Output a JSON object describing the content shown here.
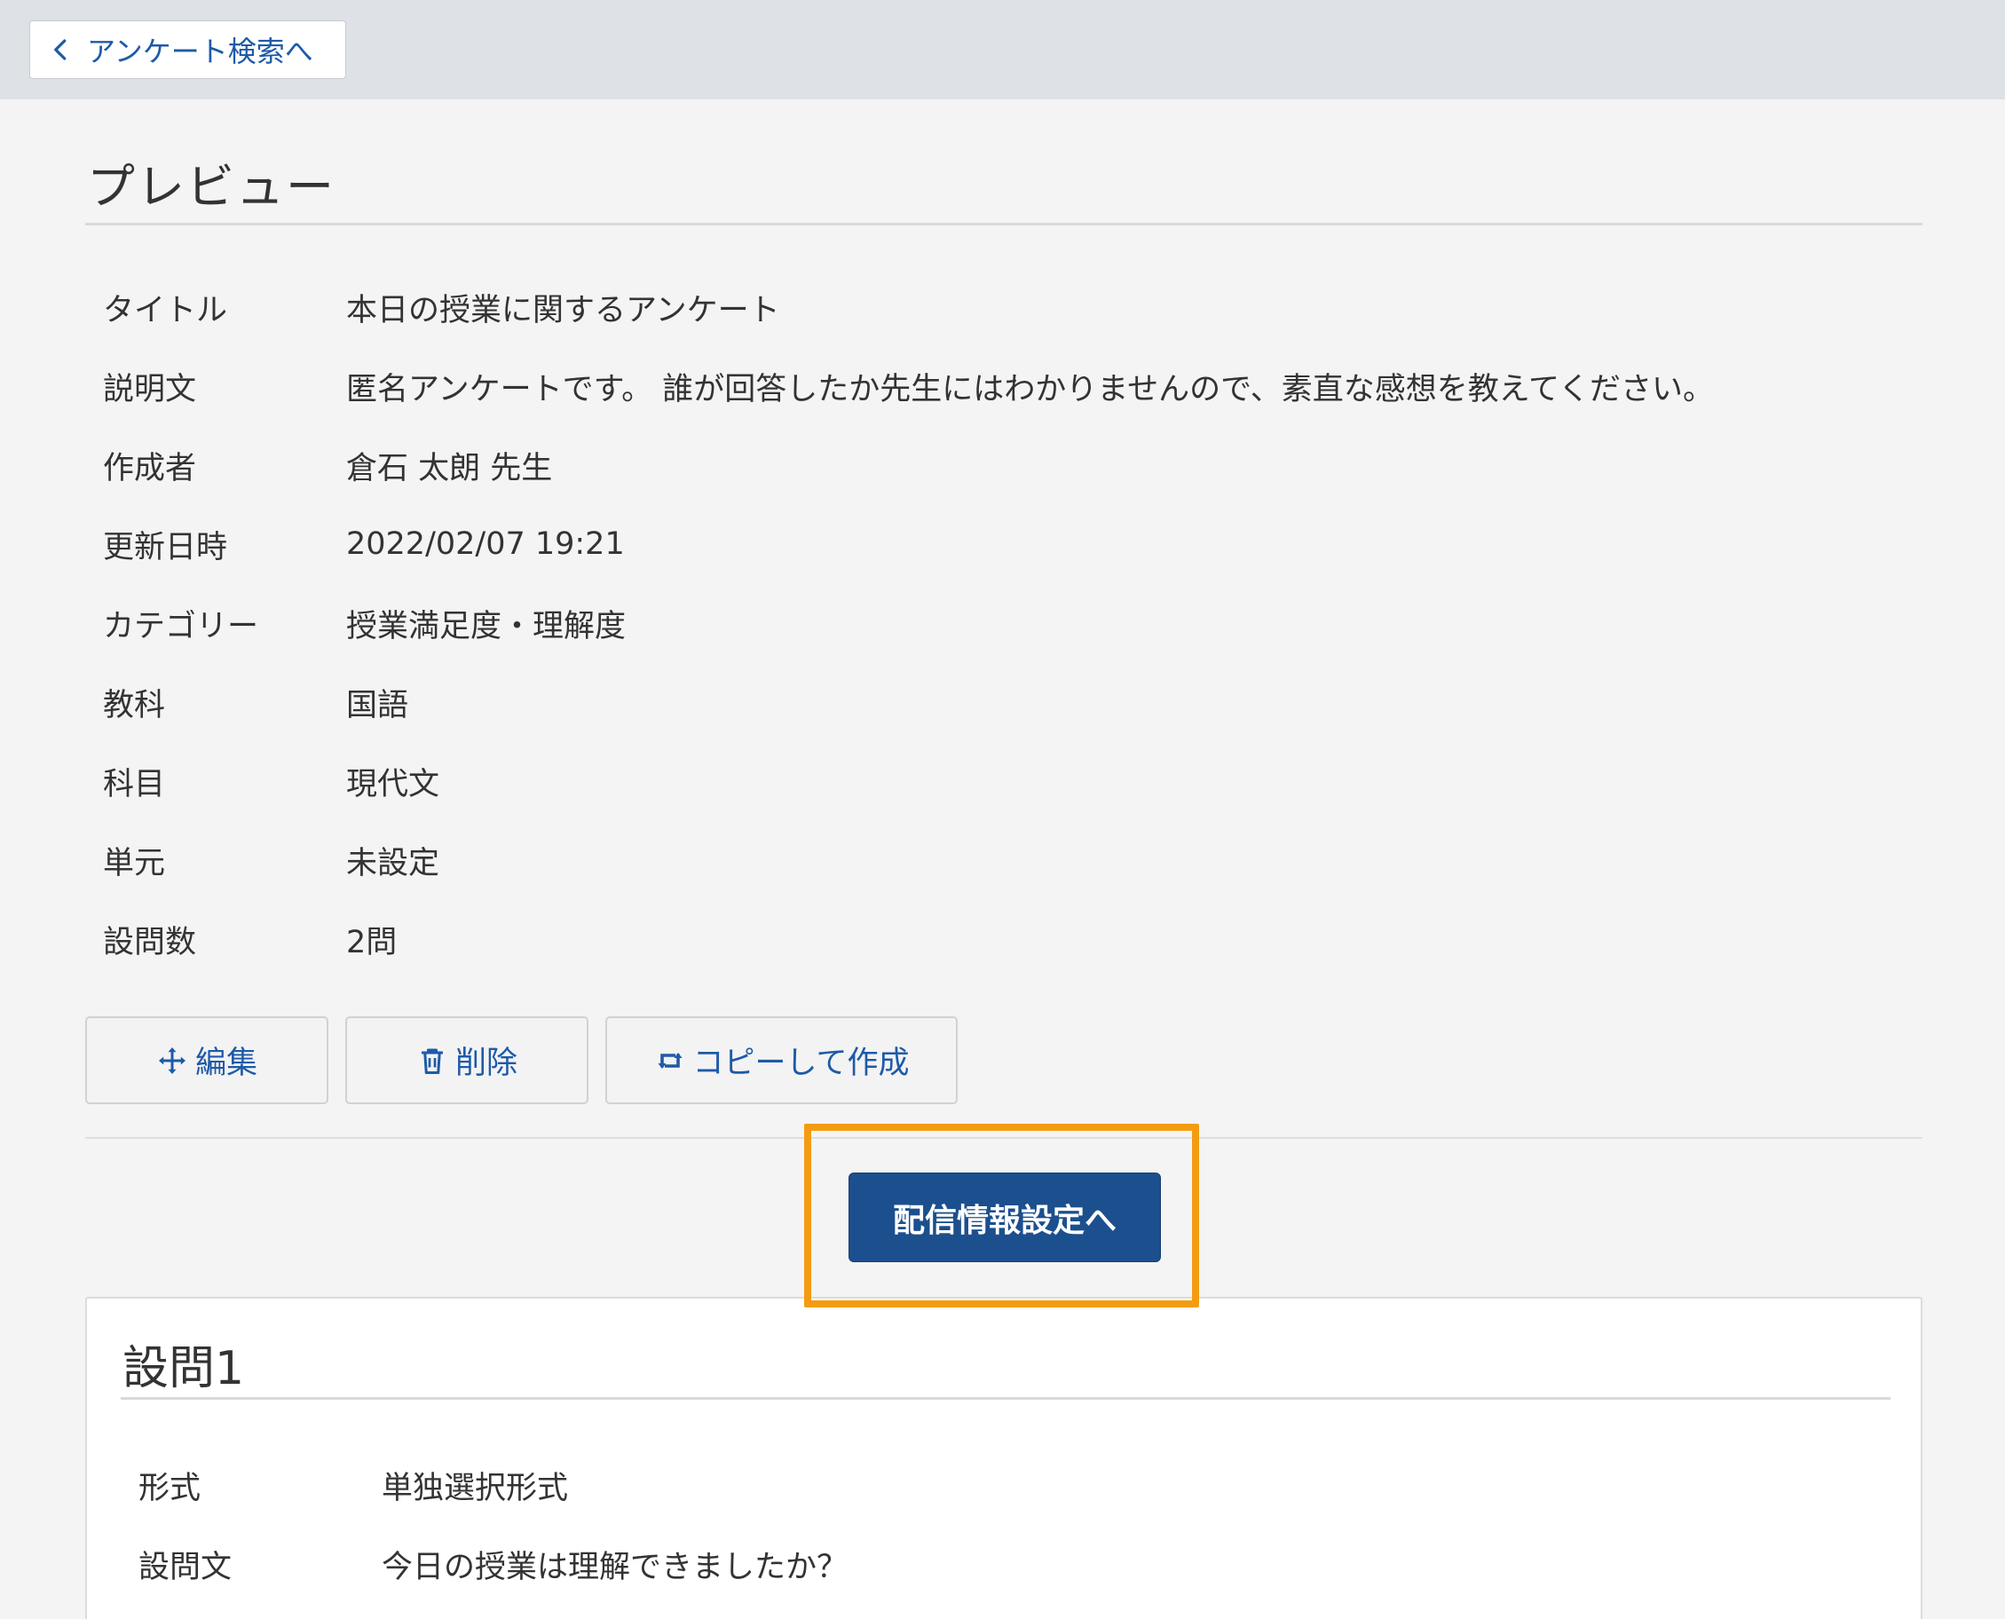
{
  "topbar": {
    "back_label": "アンケート検索へ"
  },
  "page_title": "プレビュー",
  "info": [
    {
      "label": "タイトル",
      "value": "本日の授業に関するアンケート"
    },
    {
      "label": "説明文",
      "value": "匿名アンケートです。 誰が回答したか先生にはわかりませんので、素直な感想を教えてください。"
    },
    {
      "label": "作成者",
      "value": "倉石 太朗 先生"
    },
    {
      "label": "更新日時",
      "value": "2022/02/07 19:21"
    },
    {
      "label": "カテゴリー",
      "value": "授業満足度・理解度"
    },
    {
      "label": "教科",
      "value": "国語"
    },
    {
      "label": "科目",
      "value": "現代文"
    },
    {
      "label": "単元",
      "value": "未設定"
    },
    {
      "label": "設問数",
      "value": "2問"
    }
  ],
  "actions": {
    "edit_label": "編集",
    "delete_label": "削除",
    "copy_label": "コピーして作成"
  },
  "primary": {
    "label": "配信情報設定へ"
  },
  "question": {
    "title": "設問1",
    "rows": [
      {
        "label": "形式",
        "value": "単独選択形式"
      },
      {
        "label": "設問文",
        "value": "今日の授業は理解できましたか？"
      }
    ]
  },
  "colors": {
    "link_blue": "#1e5aa8",
    "primary_blue": "#1c4f8e",
    "highlight_orange": "#f39c12",
    "topbar_gray": "#dee1e5"
  },
  "icons": {
    "back": "chevron-left-icon",
    "edit": "move-arrows-icon",
    "delete": "trash-icon",
    "copy": "retweet-icon"
  }
}
